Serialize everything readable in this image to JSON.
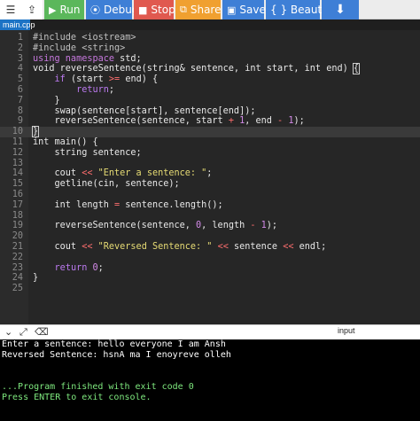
{
  "toolbar": {
    "run_label": "Run",
    "debug_label": "Debug",
    "stop_label": "Stop",
    "share_label": "Share",
    "save_label": "Save",
    "beautify_label": "{ } Beautify",
    "colors": {
      "run": "#5bb75b",
      "debug": "#3e7fd6",
      "stop": "#e0594f",
      "share": "#f0a030"
    }
  },
  "tab": {
    "label": "main.cpp"
  },
  "editor": {
    "line_numbers": [
      "1",
      "2",
      "3",
      "4",
      "5",
      "6",
      "7",
      "8",
      "9",
      "10",
      "11",
      "12",
      "13",
      "14",
      "15",
      "16",
      "17",
      "18",
      "19",
      "20",
      "21",
      "22",
      "23",
      "24",
      "25"
    ]
  },
  "console": {
    "input_label": "input",
    "lines": [
      "Enter a sentence: hello everyone I am Ansh",
      "Reversed Sentence: hsnA ma I enoyreve olleh",
      "",
      "",
      "...Program finished with exit code 0",
      "Press ENTER to exit console."
    ]
  }
}
